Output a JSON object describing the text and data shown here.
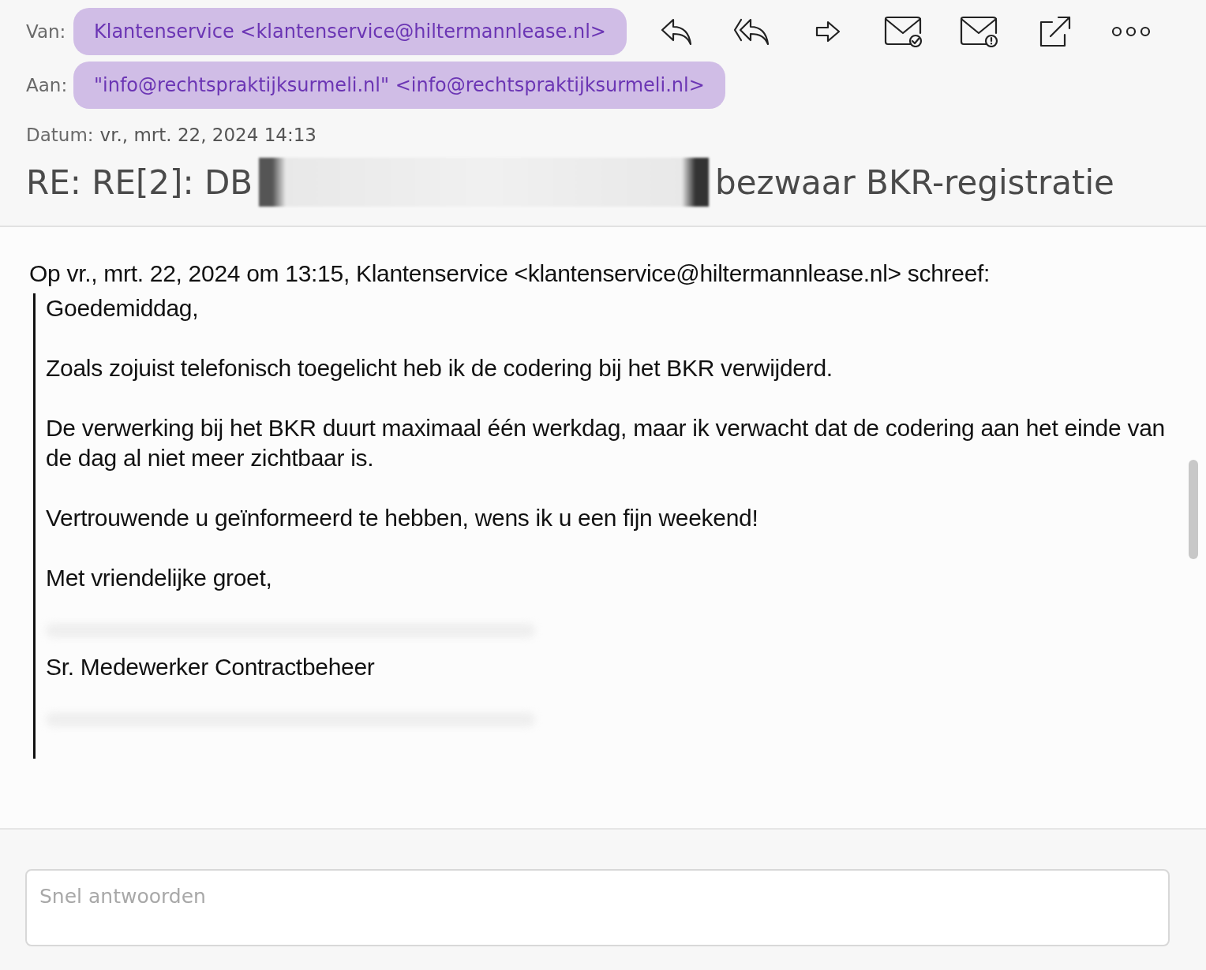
{
  "header": {
    "from": {
      "label": "Van:",
      "value": "Klantenservice <klantenservice@hiltermannlease.nl>"
    },
    "to": {
      "label": "Aan:",
      "value": "\"info@rechtspraktijksurmeli.nl\" <info@rechtspraktijksurmeli.nl>"
    },
    "toolbar": [
      {
        "kind": "reply"
      },
      {
        "kind": "reply-all"
      },
      {
        "kind": "forward"
      },
      {
        "kind": "mail-check"
      },
      {
        "kind": "mail-alert"
      },
      {
        "kind": "external"
      },
      {
        "kind": "more"
      }
    ],
    "date": {
      "label": "Datum:",
      "value": "vr., mrt. 22, 2024 14:13"
    },
    "subject": [
      {
        "kind": "text",
        "text": "RE: RE[2]: DB"
      },
      {
        "kind": "redacted"
      },
      {
        "kind": "text",
        "text": "bezwaar BKR-registratie"
      }
    ]
  },
  "message": {
    "quote_header": "Op vr., mrt. 22, 2024 om 13:15, Klantenservice <klantenservice@hiltermannlease.nl> schreef:",
    "paragraphs": [
      {
        "kind": "text",
        "text": "Goedemiddag,"
      },
      {
        "kind": "text",
        "text": "Zoals zojuist telefonisch toegelicht heb ik de codering bij het BKR verwijderd."
      },
      {
        "kind": "text",
        "text": "De verwerking bij het BKR duurt maximaal één werkdag, maar ik verwacht dat de codering aan het einde van de dag al niet meer zichtbaar is."
      },
      {
        "kind": "text",
        "text": "Vertrouwende u geïnformeerd te hebben, wens ik u een fijn weekend!"
      },
      {
        "kind": "text",
        "text": "Met vriendelijke groet,"
      },
      {
        "kind": "redacted"
      },
      {
        "kind": "line",
        "text": "Sr. Medewerker Contractbeheer"
      },
      {
        "kind": "redacted"
      }
    ]
  },
  "quick_reply": {
    "placeholder": "Snel antwoorden"
  }
}
